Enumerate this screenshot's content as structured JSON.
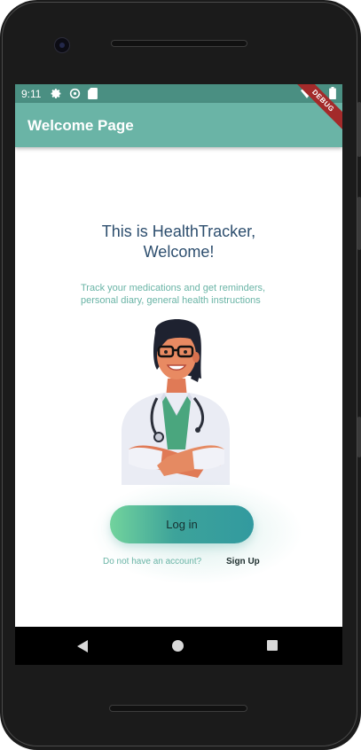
{
  "status_bar": {
    "time": "9:11",
    "icons": [
      "settings-icon",
      "sync-icon",
      "sd-card-icon",
      "wifi-icon",
      "battery-icon"
    ]
  },
  "app_bar": {
    "title": "Welcome Page",
    "debug_banner": "DEBUG",
    "color": "#6ab4a6"
  },
  "main": {
    "heading_line1": "This is HealthTracker,",
    "heading_line2": "Welcome!",
    "subtitle_line1": "Track your medications and get reminders,",
    "subtitle_line2": "personal diary, general health instructions",
    "illustration": "doctor-illustration",
    "login_label": "Log in",
    "account_prompt": "Do not have an account?",
    "signup_label": "Sign Up"
  },
  "nav_bar": {
    "icons": [
      "back-icon",
      "home-icon",
      "recent-apps-icon"
    ]
  },
  "colors": {
    "accent": "#6ab4a6",
    "heading": "#2d4e6e",
    "status_bar": "#4a8f82"
  }
}
